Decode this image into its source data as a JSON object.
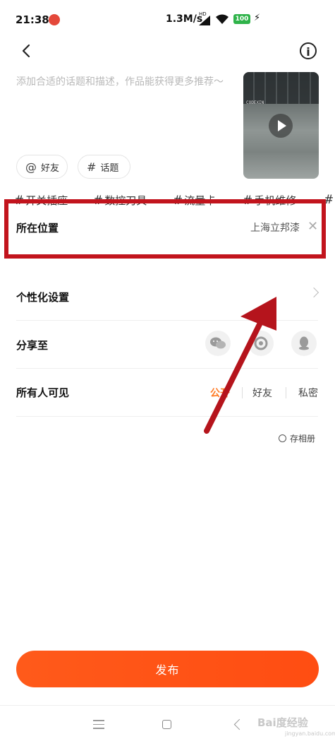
{
  "status_bar": {
    "time": "21:38",
    "network_speed": "1.3M/s",
    "hd_label": "HD",
    "battery": "100"
  },
  "header": {
    "back_icon": "chevron-left-icon",
    "info_icon": "info-circle-icon"
  },
  "description": {
    "placeholder": "添加合适的话题和描述，作品能获得更多推荐～"
  },
  "video_thumbnail": {
    "overlay_text": "CODEXIN"
  },
  "chips": [
    {
      "icon": "@",
      "label": "好友"
    },
    {
      "icon": "#",
      "label": "话题"
    }
  ],
  "suggested_topics": [
    "开关插座",
    "数控刀具",
    "流量卡",
    "手机维修"
  ],
  "topic_hash": "#",
  "settings": {
    "location": {
      "label": "所在位置",
      "value": "上海立邦漆",
      "clear_icon": "close-icon"
    },
    "personalization": {
      "label": "个性化设置"
    },
    "share": {
      "label": "分享至",
      "targets": [
        "wechat-icon",
        "moments-icon",
        "qq-icon"
      ]
    },
    "visibility": {
      "label": "所有人可见",
      "options": [
        "公开",
        "好友",
        "私密"
      ],
      "selected": "公开"
    }
  },
  "save_to_album": {
    "label": "存相册"
  },
  "publish_button": {
    "label": "发布"
  },
  "watermark": {
    "main": "Bai度经验",
    "sub": "jingyan.baidu.com"
  },
  "colors": {
    "accent": "#ff5a1a",
    "highlight_box": "#c2141d",
    "arrow": "#b5141c"
  }
}
